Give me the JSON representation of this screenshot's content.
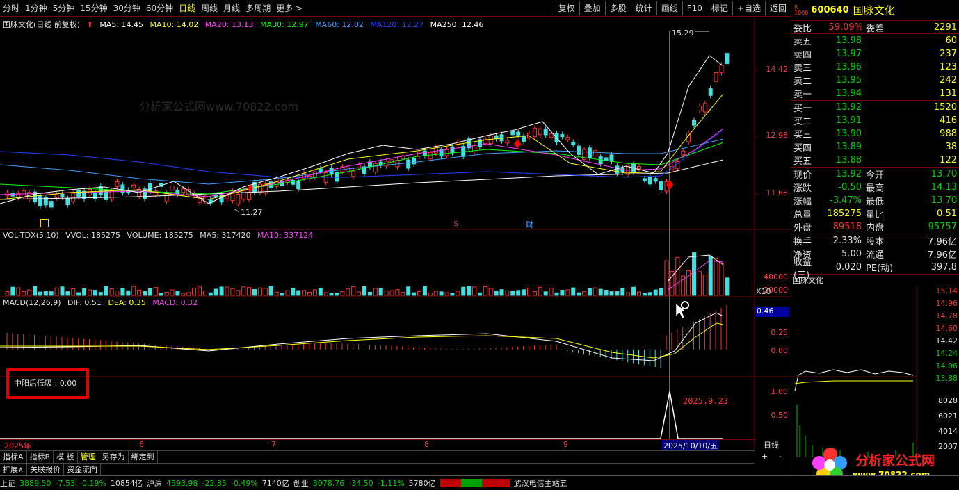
{
  "toolbar": {
    "periods": [
      "分时",
      "1分钟",
      "5分钟",
      "15分钟",
      "30分钟",
      "60分钟",
      "日线",
      "周线",
      "月线",
      "多周期",
      "更多 >"
    ],
    "active_index": 6,
    "buttons": [
      "复权",
      "叠加",
      "多股",
      "统计",
      "画线",
      "F10",
      "标记",
      "+自选",
      "返回"
    ]
  },
  "main_chart": {
    "title": "国脉文化(日线 前复权)",
    "ma": {
      "ma5": "MA5: 14.45",
      "ma10": "MA10: 14.02",
      "ma20": "MA20: 13.13",
      "ma30": "MA30: 12.97",
      "ma60": "MA60: 12.82",
      "ma120": "MA120: 12.27",
      "ma250": "MA250: 12.46"
    },
    "price_axis": [
      "14.42",
      "12.98",
      "11.68"
    ],
    "high_label": "15.29",
    "low_label": "11.27",
    "markers": {
      "s": "$",
      "cai": "财"
    },
    "watermark": "分析家公式网www.70822.com"
  },
  "vol_panel": {
    "label": "VOL-TDX(5,10)",
    "vvol": "VVOL: 185275",
    "volume": "VOLUME: 185275",
    "ma5": "MA5: 317420",
    "ma10": "MA10: 337124",
    "axis": [
      "40000",
      "20000",
      "X10"
    ]
  },
  "macd_panel": {
    "label": "MACD(12,26,9)",
    "dif": "DIF: 0.51",
    "dea": "DEA: 0.35",
    "macd": "MACD: 0.32",
    "axis": [
      "0.46",
      "0.25",
      "0.00"
    ]
  },
  "custom_panel": {
    "label": "中阳后低吸 : 0.00",
    "date_note": "2025.9.23",
    "axis": [
      "1.00",
      "0.50"
    ]
  },
  "date_axis": {
    "labels": [
      "2025年",
      "6",
      "7",
      "8",
      "9"
    ],
    "cursor_date": "2025/10/10/五"
  },
  "tabs1": [
    "指标A",
    "指标B",
    "模 板",
    "管理",
    "另存为",
    "绑定到"
  ],
  "tabs1_active": 3,
  "tabs2": [
    "扩展∧",
    "关联报价",
    "资金流向"
  ],
  "quote": {
    "code": "600640",
    "name": "国脉文化",
    "weibi_label": "委比",
    "weibi": "59.09%",
    "weicha_label": "委差",
    "weicha": "2291",
    "sell": [
      {
        "label": "卖五",
        "price": "13.98",
        "vol": "60"
      },
      {
        "label": "卖四",
        "price": "13.97",
        "vol": "237"
      },
      {
        "label": "卖三",
        "price": "13.96",
        "vol": "123"
      },
      {
        "label": "卖二",
        "price": "13.95",
        "vol": "242"
      },
      {
        "label": "卖一",
        "price": "13.94",
        "vol": "131"
      }
    ],
    "buy": [
      {
        "label": "买一",
        "price": "13.92",
        "vol": "1520"
      },
      {
        "label": "买二",
        "price": "13.91",
        "vol": "416"
      },
      {
        "label": "买三",
        "price": "13.90",
        "vol": "988"
      },
      {
        "label": "买四",
        "price": "13.89",
        "vol": "38"
      },
      {
        "label": "买五",
        "price": "13.88",
        "vol": "122"
      }
    ],
    "stats": [
      {
        "l1": "现价",
        "v1": "13.92",
        "c1": "green",
        "l2": "今开",
        "v2": "13.70",
        "c2": "green"
      },
      {
        "l1": "涨跌",
        "v1": "-0.50",
        "c1": "green",
        "l2": "最高",
        "v2": "14.13",
        "c2": "green"
      },
      {
        "l1": "涨幅",
        "v1": "-3.47%",
        "c1": "green",
        "l2": "最低",
        "v2": "13.70",
        "c2": "green"
      },
      {
        "l1": "总量",
        "v1": "185275",
        "c1": "yellow",
        "l2": "量比",
        "v2": "0.51",
        "c2": "yellow"
      },
      {
        "l1": "外盘",
        "v1": "89518",
        "c1": "red",
        "l2": "内盘",
        "v2": "95757",
        "c2": "green"
      }
    ],
    "stats2": [
      {
        "l1": "换手",
        "v1": "2.33%",
        "l2": "股本",
        "v2": "7.96亿"
      },
      {
        "l1": "净资",
        "v1": "5.00",
        "l2": "流通",
        "v2": "7.96亿"
      },
      {
        "l1": "收益(三)",
        "v1": "0.020",
        "l2": "PE(动)",
        "v2": "397.8"
      }
    ]
  },
  "mini_chart": {
    "title": "国脉文化",
    "axis": [
      "15.14",
      "14.96",
      "14.78",
      "14.60",
      "14.42",
      "14.24",
      "14.06",
      "13.88",
      "8028",
      "6021",
      "4014",
      "2007"
    ]
  },
  "status_bar": {
    "sh_label": "上证",
    "sh_val": "3889.50",
    "sh_chg": "-7.53",
    "sh_pct": "-0.19%",
    "sh_amt": "10854亿",
    "hs_label": "沪深",
    "hs_val": "4593.98",
    "hs_chg": "-22.85",
    "hs_pct": "-0.49%",
    "hs_amt": "7140亿",
    "cy_label": "创业",
    "cy_val": "3078.76",
    "cy_chg": "-34.50",
    "cy_pct": "-1.11%",
    "cy_amt": "5780亿",
    "server": "武汉电信主站五"
  },
  "logo": {
    "text": "分析家公式网",
    "url": "www.70822.com"
  },
  "colors": {
    "up": "#ff3333",
    "down": "#40e0e0",
    "ma5": "#ffffff",
    "ma10": "#ffff00",
    "ma20": "#ff40ff",
    "ma30": "#00ff00",
    "ma60": "#40a0ff",
    "ma120": "#2040ff",
    "ma250": "#ffffff"
  }
}
